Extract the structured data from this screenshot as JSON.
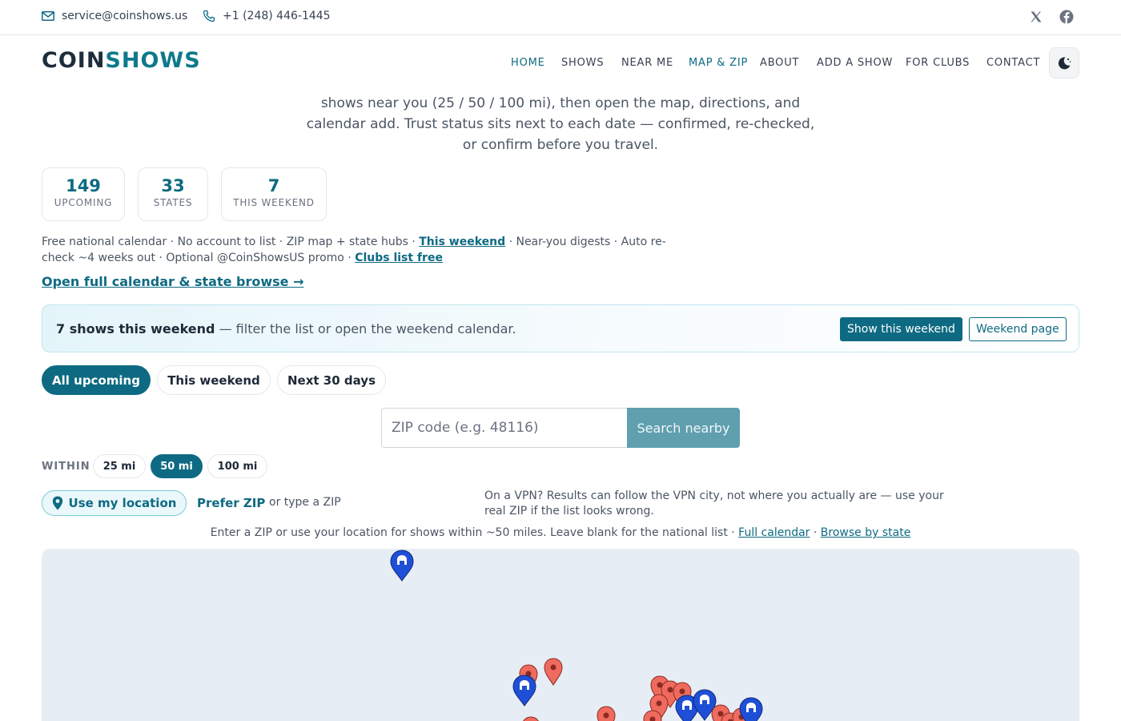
{
  "topbar": {
    "email": "service@coinshows.us",
    "phone": "+1 (248) 446-1445",
    "social_icons": [
      "x-icon",
      "facebook-icon"
    ]
  },
  "header": {
    "logo_part1": "COIN",
    "logo_part2": "SHOWS",
    "nav": [
      {
        "label": "HOME",
        "active": true
      },
      {
        "label": "SHOWS",
        "active": false
      },
      {
        "label": "NEAR ME",
        "active": false
      },
      {
        "label": "MAP & ZIP",
        "active": true
      },
      {
        "label": "ABOUT",
        "active": false
      },
      {
        "label": "ADD A SHOW",
        "active": false
      },
      {
        "label": "FOR CLUBS",
        "active": false
      },
      {
        "label": "CONTACT",
        "active": false
      }
    ],
    "theme_icon": "moon-icon"
  },
  "intro": {
    "line1": "shows near you (25 / 50 / 100 mi), then open the map, directions, and",
    "line2": "calendar add. Trust status sits next to each date — confirmed, re-checked,",
    "line3": "or confirm before you travel."
  },
  "stats": [
    {
      "value": "149",
      "label": "UPCOMING"
    },
    {
      "value": "33",
      "label": "STATES"
    },
    {
      "value": "7",
      "label": "THIS WEEKEND"
    }
  ],
  "features": {
    "text1": "Free national calendar · No account to list · ZIP map + state hubs · ",
    "link1": "This weekend",
    "text2": " · Near-you digests · Auto re-check ~4 weeks out · Optional @CoinShowsUS promo · ",
    "link2": "Clubs list free"
  },
  "full_calendar_link": "Open full calendar & state browse →",
  "banner": {
    "bold": "7 shows this weekend",
    "rest": " — filter the list or open the weekend calendar.",
    "btn_show": "Show this weekend",
    "btn_page": "Weekend page"
  },
  "filters": {
    "items": [
      "All upcoming",
      "This weekend",
      "Next 30 days"
    ],
    "selected": "All upcoming"
  },
  "zip": {
    "placeholder": "ZIP code (e.g. 48116)",
    "value": "",
    "button": "Search nearby"
  },
  "radius": {
    "label": "WITHIN",
    "options": [
      "25 mi",
      "50 mi",
      "100 mi"
    ],
    "selected": "50 mi"
  },
  "location": {
    "button": "Use my location",
    "prefer": "Prefer ZIP",
    "or_type": "or type a ZIP",
    "vpn_note": "On a VPN? Results can follow the VPN city, not where you actually are — use your real ZIP if the list looks wrong."
  },
  "hint": {
    "text": "Enter a ZIP or use your location for shows within ~50 miles. Leave blank for the national list · ",
    "link1": "Full calendar",
    "sep": " · ",
    "link2": "Browse by state"
  },
  "colors": {
    "accent": "#0e6a82",
    "marker_red": "#ef6b5e",
    "marker_blue": "#1f4fd6",
    "map_bg": "#e6edf5"
  },
  "map": {
    "marker_icons": [
      "map-pin-red-icon",
      "map-pin-blue-icon"
    ]
  }
}
